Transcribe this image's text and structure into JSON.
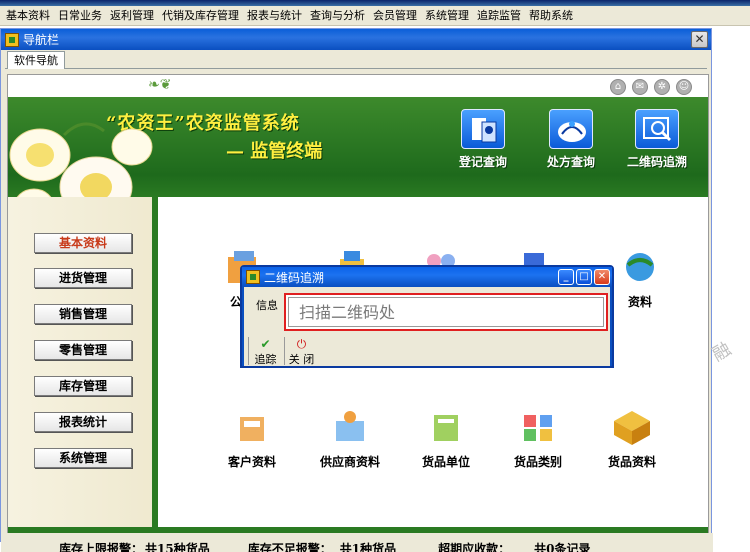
{
  "menu": {
    "items": [
      "基本资料",
      "日常业务",
      "返利管理",
      "代销及库存管理",
      "报表与统计",
      "查询与分析",
      "会员管理",
      "系统管理",
      "追踪监管",
      "帮助系统"
    ]
  },
  "nav_window": {
    "title": "导航栏",
    "close_glyph": "✕",
    "tab": "软件导航"
  },
  "banner": {
    "deco": "❧❦",
    "title": "“农资王”农资监管系统",
    "subtitle": "— 监管终端",
    "top_icons": [
      "home-icon",
      "mail-icon",
      "settings-icon",
      "smile-icon"
    ],
    "quick_links": [
      {
        "label": "登记查询",
        "icon": "register-query-icon"
      },
      {
        "label": "处方查询",
        "icon": "prescription-query-icon"
      },
      {
        "label": "二维码追溯",
        "icon": "qrcode-trace-icon"
      }
    ]
  },
  "sidebar": {
    "items": [
      {
        "label": "基本资料",
        "active": true
      },
      {
        "label": "进货管理",
        "active": false
      },
      {
        "label": "销售管理",
        "active": false
      },
      {
        "label": "零售管理",
        "active": false
      },
      {
        "label": "库存管理",
        "active": false
      },
      {
        "label": "报表统计",
        "active": false
      },
      {
        "label": "系统管理",
        "active": false
      }
    ]
  },
  "tiles": {
    "row1": [
      {
        "label": "公司",
        "icon": "company-icon"
      },
      {
        "label": "",
        "icon": "goods-box-icon"
      },
      {
        "label": "",
        "icon": "staff-icon"
      },
      {
        "label": "",
        "icon": "warehouse-icon"
      },
      {
        "label": "资料",
        "icon": "globe-icon"
      }
    ],
    "row2": [
      {
        "label": "客户资料",
        "icon": "customer-icon"
      },
      {
        "label": "供应商资料",
        "icon": "supplier-icon"
      },
      {
        "label": "货品单位",
        "icon": "unit-icon"
      },
      {
        "label": "货品类别",
        "icon": "category-icon"
      },
      {
        "label": "货品资料",
        "icon": "goods-icon"
      }
    ]
  },
  "watermark": "融",
  "status": {
    "upper_alert_label": "库存上限报警：",
    "upper_alert_value": "共15种货品",
    "lower_alert_label": "库存不足报警：",
    "lower_alert_value": "共1种货品",
    "overdue_label": "超期应收款：",
    "overdue_value": "共0条记录"
  },
  "dialog": {
    "title": "二维码追溯",
    "min_glyph": "_",
    "max_glyph": "□",
    "close_glyph": "✕",
    "info_label": "信息",
    "input_placeholder": "扫描二维码处",
    "input_value": "",
    "trace_button": "追踪",
    "close_button": "关 闭",
    "highlight_color": "#e02020"
  },
  "colors": {
    "banner_green": "#2a7a22",
    "title_yellow": "#ffef40",
    "accent_red": "#c83a1a"
  }
}
